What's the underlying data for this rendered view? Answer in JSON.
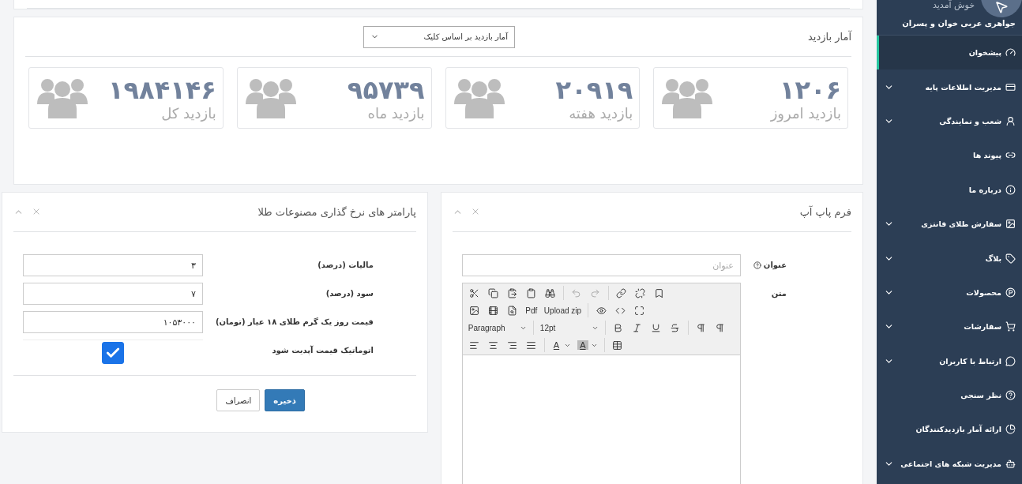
{
  "sidebar": {
    "welcome": "خوش آمدید",
    "user_name": "جواهری عربی خوان و پسران",
    "items": [
      {
        "label": "پیشخوان",
        "expandable": false,
        "selected": true
      },
      {
        "label": "مدیریت اطلاعات پایه",
        "expandable": true,
        "selected": false
      },
      {
        "label": "شعب و نمایندگی",
        "expandable": true,
        "selected": false
      },
      {
        "label": "پیوند ها",
        "expandable": false,
        "selected": false
      },
      {
        "label": "درباره ما",
        "expandable": false,
        "selected": false
      },
      {
        "label": "سفارش طلای فانتزی",
        "expandable": true,
        "selected": false
      },
      {
        "label": "بلاگ",
        "expandable": true,
        "selected": false
      },
      {
        "label": "محصولات",
        "expandable": true,
        "selected": false
      },
      {
        "label": "سفارشات",
        "expandable": true,
        "selected": false
      },
      {
        "label": "ارتباط با کاربران",
        "expandable": true,
        "selected": false
      },
      {
        "label": "نظر سنجی",
        "expandable": false,
        "selected": false
      },
      {
        "label": "ارائه آمار بازدیدکنندگان",
        "expandable": false,
        "selected": false
      },
      {
        "label": "مدیریت شبکه های اجتماعی",
        "expandable": true,
        "selected": false
      }
    ]
  },
  "visits": {
    "title": "آمار بازدید",
    "filter": "آمار بازدید بر اساس کلیک",
    "stats": [
      {
        "value": "۱۲۰۶",
        "label": "بازدید امروز"
      },
      {
        "value": "۲۰۹۱۹",
        "label": "بازدید هفته"
      },
      {
        "value": "۹۵۷۳۹",
        "label": "بازدید ماه"
      },
      {
        "value": "۱۹۸۴۱۴۶",
        "label": "بازدید کل"
      }
    ]
  },
  "popup_form": {
    "title": "فرم پاپ آپ",
    "title_label": "عنوان",
    "title_placeholder": "عنوان",
    "body_label": "متن",
    "editor": {
      "pdf": "Pdf",
      "upload": "Upload zip",
      "block_format": "Paragraph",
      "font_size": "12pt",
      "text_color": "A",
      "background_color": "A"
    }
  },
  "pricing": {
    "title": "پارامتر های نرخ گذاری مصنوعات طلا",
    "fields": [
      {
        "label": "مالیات (درصد)",
        "value": "۳"
      },
      {
        "label": "سود (درصد)",
        "value": "۷"
      },
      {
        "label": "قیمت روز یک گرم طلای ۱۸ عیار (تومان)",
        "value": "۱۰۵۳۰۰۰"
      }
    ],
    "auto_update": {
      "label": "اتوماتیک قیمت آپدیت شود",
      "checked": true
    },
    "buttons": [
      {
        "label": "ذخیره",
        "kind": "primary"
      },
      {
        "label": "انصراف",
        "kind": "default"
      }
    ]
  }
}
